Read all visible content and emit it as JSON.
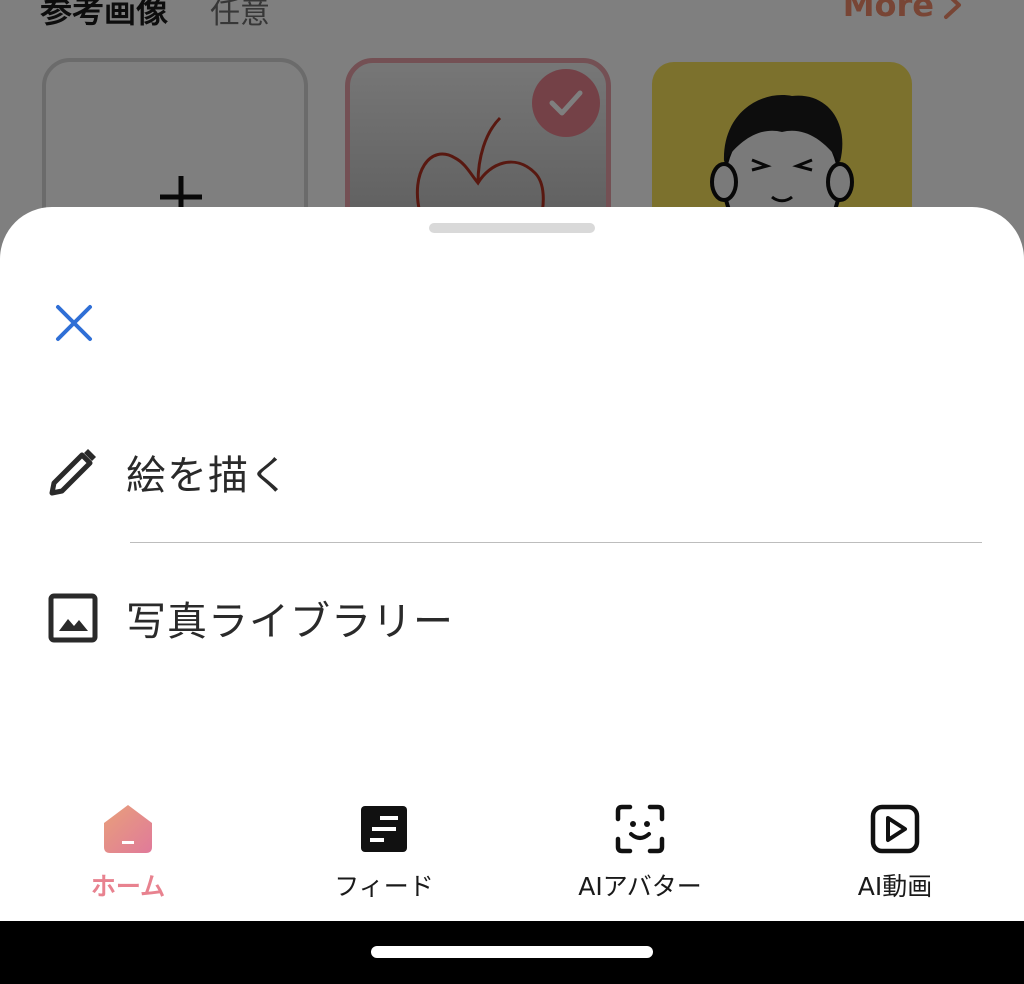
{
  "background": {
    "section_title": "参考画像",
    "section_subtitle": "任意",
    "more_label": "More"
  },
  "sheet": {
    "options": [
      {
        "label": "絵を描く",
        "icon": "pencil-icon"
      },
      {
        "label": "写真ライブラリー",
        "icon": "image-icon"
      }
    ]
  },
  "tabs": [
    {
      "label": "ホーム",
      "icon": "home-icon",
      "active": true
    },
    {
      "label": "フィード",
      "icon": "feed-icon",
      "active": false
    },
    {
      "label": "AIアバター",
      "icon": "face-scan-icon",
      "active": false
    },
    {
      "label": "AI動画",
      "icon": "play-video-icon",
      "active": false
    }
  ],
  "colors": {
    "accent": "#e8828f",
    "close_icon": "#2f6fd6",
    "dim_overlay": "rgba(0,0,0,0.5)",
    "system_bar": "#000000"
  }
}
